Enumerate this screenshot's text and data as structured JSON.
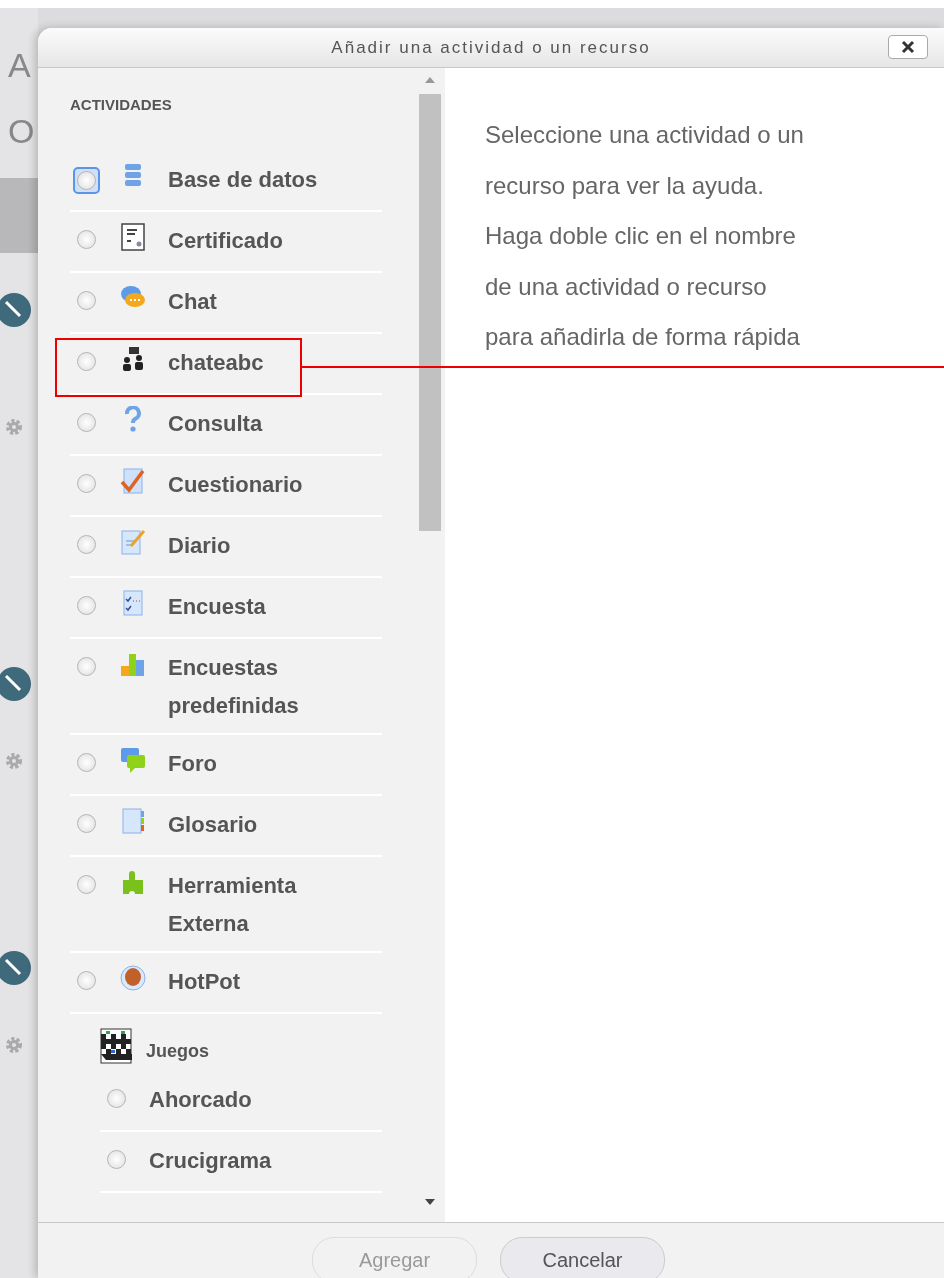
{
  "background_page": {
    "heading_letters": [
      "A",
      "O"
    ]
  },
  "dialog": {
    "title": "Añadir una actividad o un recurso",
    "section_heading": "ACTIVIDADES",
    "items": [
      {
        "kind": "option",
        "label": "Base de datos",
        "selected": false,
        "focused": true,
        "highlighted": false
      },
      {
        "kind": "option",
        "label": "Certificado",
        "selected": false,
        "focused": false,
        "highlighted": false
      },
      {
        "kind": "option",
        "label": "Chat",
        "selected": false,
        "focused": false,
        "highlighted": false
      },
      {
        "kind": "option",
        "label": "chateabc",
        "selected": false,
        "focused": false,
        "highlighted": true
      },
      {
        "kind": "option",
        "label": "Consulta",
        "selected": false,
        "focused": false,
        "highlighted": false
      },
      {
        "kind": "option",
        "label": "Cuestionario",
        "selected": false,
        "focused": false,
        "highlighted": false
      },
      {
        "kind": "option",
        "label": "Diario",
        "selected": false,
        "focused": false,
        "highlighted": false
      },
      {
        "kind": "option",
        "label": "Encuesta",
        "selected": false,
        "focused": false,
        "highlighted": false
      },
      {
        "kind": "option",
        "label": "Encuestas predefinidas",
        "selected": false,
        "focused": false,
        "highlighted": false
      },
      {
        "kind": "option",
        "label": "Foro",
        "selected": false,
        "focused": false,
        "highlighted": false
      },
      {
        "kind": "option",
        "label": "Glosario",
        "selected": false,
        "focused": false,
        "highlighted": false
      },
      {
        "kind": "option",
        "label": "Herramienta Externa",
        "selected": false,
        "focused": false,
        "highlighted": false
      },
      {
        "kind": "option",
        "label": "HotPot",
        "selected": false,
        "focused": false,
        "highlighted": false
      },
      {
        "kind": "group",
        "label": "Juegos",
        "children": [
          {
            "kind": "option",
            "label": "Ahorcado",
            "selected": false,
            "focused": false,
            "highlighted": false
          },
          {
            "kind": "option",
            "label": "Crucigrama",
            "selected": false,
            "focused": false,
            "highlighted": false
          }
        ]
      }
    ],
    "help_text": "Seleccione una actividad o un recurso para ver la ayuda. Haga doble clic en el nombre de una actividad o recurso para añadirla de forma rápida",
    "buttons": [
      {
        "label": "Agregar",
        "disabled": true
      },
      {
        "label": "Cancelar",
        "disabled": false
      }
    ]
  }
}
